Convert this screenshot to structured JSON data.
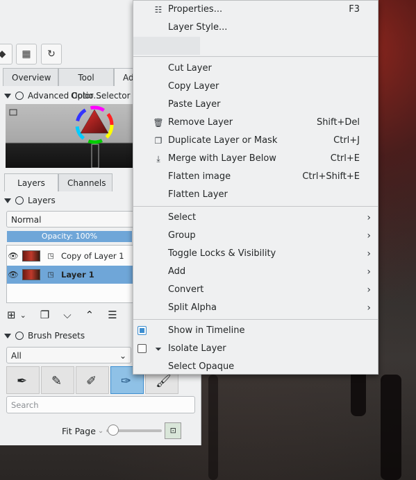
{
  "docker": {
    "tabs": [
      "Overview",
      "Tool Optio...",
      "Adv"
    ],
    "color_selector_title": "Advanced Color Selector",
    "layers_tabs": [
      "Layers",
      "Channels"
    ],
    "layers_title": "Layers",
    "blend_mode": "Normal",
    "opacity": "Opacity:  100%",
    "layers": [
      {
        "name": "Copy of Layer 1",
        "selected": false
      },
      {
        "name": "Layer 1",
        "selected": true
      }
    ],
    "brush_presets_title": "Brush Presets",
    "brush_filter": "All",
    "search_placeholder": "Search",
    "zoom_label": "Fit Page"
  },
  "menu": {
    "top_items": [
      {
        "label": "Properties...",
        "shortcut": "F3",
        "icon": "sliders-icon"
      },
      {
        "label": "Layer Style...",
        "shortcut": ""
      }
    ],
    "edit_items": [
      {
        "label": "Cut Layer",
        "shortcut": ""
      },
      {
        "label": "Copy Layer",
        "shortcut": ""
      },
      {
        "label": "Paste Layer",
        "shortcut": ""
      },
      {
        "label": "Remove Layer",
        "shortcut": "Shift+Del",
        "icon": "trash-icon"
      },
      {
        "label": "Duplicate Layer or Mask",
        "shortcut": "Ctrl+J",
        "icon": "duplicate-icon"
      },
      {
        "label": "Merge with Layer Below",
        "shortcut": "Ctrl+E",
        "icon": "merge-down-icon"
      },
      {
        "label": "Flatten image",
        "shortcut": "Ctrl+Shift+E"
      },
      {
        "label": "Flatten Layer",
        "shortcut": ""
      }
    ],
    "submenus": [
      "Select",
      "Group",
      "Toggle Locks & Visibility",
      "Add",
      "Convert",
      "Split Alpha"
    ],
    "bottom_items": [
      {
        "label": "Show in Timeline",
        "checked": true
      },
      {
        "label": "Isolate Layer",
        "checked": false,
        "icon": "funnel-icon"
      },
      {
        "label": "Select Opaque"
      }
    ]
  },
  "colors": {
    "accent": "#3d8ed0",
    "selection": "#6fa6d8",
    "menu_bg": "#eff0f1"
  }
}
